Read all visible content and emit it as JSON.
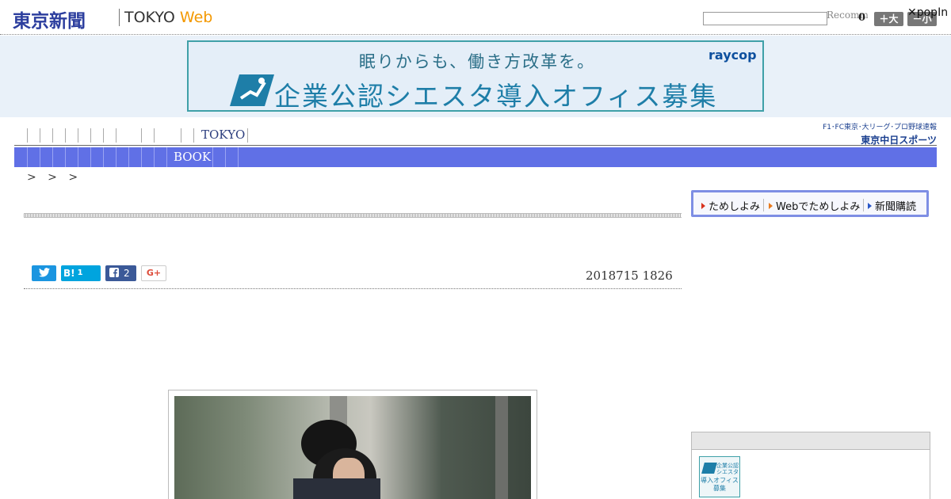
{
  "header": {
    "logo_jp": "東京新聞",
    "logo_tokyo": "TOKYO",
    "logo_web": "Web",
    "search_value": "",
    "recommend_text": "Recommend",
    "count": "0",
    "size_big": "＋大",
    "size_small": "－小",
    "popin": "✕popIn"
  },
  "ad": {
    "line1": "眠りからも、働き方改革を。",
    "line2": "企業公認シエスタ導入オフィス募集",
    "brand": "raycop"
  },
  "nav": {
    "primary_tokyo": "TOKYO",
    "chunichi_top": "F1･FC東京･大リーグ･プロ野球速報",
    "chunichi_bottom": "東京中日スポーツ",
    "secondary_book": "BOOK"
  },
  "breadcrumb": "> > >",
  "article": {
    "share": {
      "hatena_label": "B!",
      "hatena_count": "1",
      "facebook_count": "2",
      "gplus_label": "G+"
    },
    "date": "2018715 1826"
  },
  "sidebar": {
    "subscribe": {
      "item1": "ためしよみ",
      "item2": "Webでためしよみ",
      "item3": "新聞購読"
    },
    "thumb_line1": "企業公認シエスタ",
    "thumb_line2": "導入オフィス募集"
  },
  "colors": {
    "brand_blue": "#2c3e9e",
    "nav_bar": "#6070e6",
    "web_orange": "#f39800",
    "twitter": "#1b95e0",
    "hatena": "#00a4de",
    "facebook": "#3b5998"
  }
}
